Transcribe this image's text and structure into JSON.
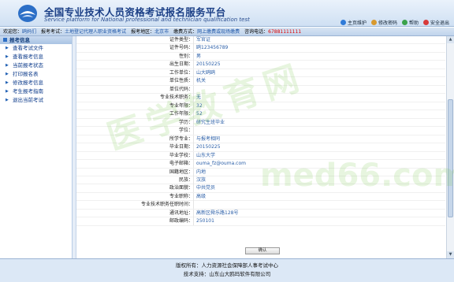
{
  "header": {
    "title": "全国专业技术人员资格考试报名服务平台",
    "subtitle": "Service platform for National professional and technician qualification test",
    "links": [
      {
        "label": "主页维护",
        "color": "#2f7bd8",
        "icon": "home-icon"
      },
      {
        "label": "修改密码",
        "color": "#d89a2f",
        "icon": "key-icon"
      },
      {
        "label": "帮助",
        "color": "#3aa24a",
        "icon": "help-icon"
      },
      {
        "label": "安全退出",
        "color": "#d83a3a",
        "icon": "exit-icon"
      }
    ]
  },
  "infobar": {
    "welcome_label": "欢迎您：",
    "welcome_value": "鸥妈们",
    "exam_label": "报考考试：",
    "exam_value": "土地登记代理人职业资格考试",
    "region_label": "报考地区：",
    "region_value": "北京市",
    "fee_label": "缴费方式：",
    "fee_value": "网上缴费或现场缴费",
    "phone_label": "咨询电话：",
    "phone_value": "67881111111"
  },
  "sidebar": {
    "head": "报考信息",
    "items": [
      {
        "label": "查看考试文件"
      },
      {
        "label": "查看报考信息"
      },
      {
        "label": "当前报考状态"
      },
      {
        "label": "打印报名表"
      },
      {
        "label": "修改报考信息"
      },
      {
        "label": "考生报考指南"
      },
      {
        "label": "退出当前考试"
      }
    ]
  },
  "form": {
    "rows": [
      {
        "k": "证件类型：",
        "v": "军官证"
      },
      {
        "k": "证件号码：",
        "v": "鸥123456789"
      },
      {
        "k": "性别：",
        "v": "男"
      },
      {
        "k": "出生日期：",
        "v": "20150225"
      },
      {
        "k": "工作单位：",
        "v": "山大鸥鸥"
      },
      {
        "k": "单位性质：",
        "v": "机关"
      },
      {
        "k": "单位代码：",
        "v": ""
      },
      {
        "k": "专业技术职务：",
        "v": "无"
      },
      {
        "k": "专业年限：",
        "v": "32"
      },
      {
        "k": "工作年限：",
        "v": "52"
      },
      {
        "k": "学历：",
        "v": "研究生班毕业"
      },
      {
        "k": "学位：",
        "v": ""
      },
      {
        "k": "所学专业：",
        "v": "与报考相同"
      },
      {
        "k": "毕业日期：",
        "v": "20150225"
      },
      {
        "k": "毕业学校：",
        "v": "山东大学"
      },
      {
        "k": "电子邮箱：",
        "v": "ouma_fz@ouma.com"
      },
      {
        "k": "国籍地区：",
        "v": "内地"
      },
      {
        "k": "民族：",
        "v": "汉族"
      },
      {
        "k": "政治面貌：",
        "v": "中共党员"
      },
      {
        "k": "专业职称：",
        "v": "高级"
      },
      {
        "k": "专业技术职务任职时间：",
        "v": ""
      },
      {
        "k": "通讯地址：",
        "v": "高新区舜乐路128号"
      },
      {
        "k": "邮政编码：",
        "v": "250101"
      }
    ],
    "confirm_label": "确认"
  },
  "footer": {
    "line1": "版权所有：人力资源社会保障部人事考试中心",
    "line2": "技术支持：山东山大鸥玛软件有限公司"
  },
  "watermark": {
    "text1": "医学教育网",
    "text2": "med66.com"
  }
}
